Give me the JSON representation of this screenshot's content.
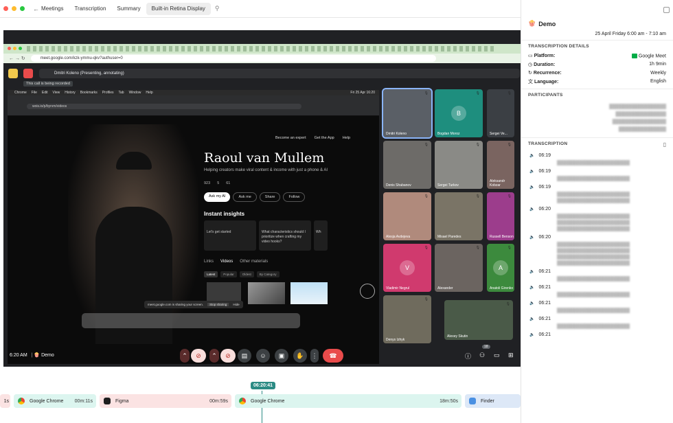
{
  "topbar": {
    "back_label": "Meetings",
    "tabs": [
      "Transcription",
      "Summary",
      "Built-in Retina Display"
    ]
  },
  "panel": {
    "title": "Demo",
    "datetime": "25 April Friday 6:00 am - 7:10 am",
    "details_heading": "TRANSCRIPTION DETAILS",
    "details": [
      {
        "label": "Platform:",
        "value": "Google Meet"
      },
      {
        "label": "Duration:",
        "value": "1h 9min"
      },
      {
        "label": "Recurrence:",
        "value": "Weekly"
      },
      {
        "label": "Language:",
        "value": "English"
      }
    ],
    "participants_heading": "PARTICIPANTS",
    "transcription_heading": "TRANSCRIPTION",
    "timestamps": [
      "06:19",
      "06:19",
      "06:19",
      "06:20",
      "06:20",
      "06:21",
      "06:21",
      "06:21",
      "06:21",
      "06:21"
    ]
  },
  "browser": {
    "url": "meet.google.com/kzk-ymmu-qkv?authuser=0",
    "presenter": "Dmitri Koleno (Presenting, annotating)",
    "recording_note": "This call is being recorded",
    "inner_url": "wois.io/p/byrvm/videos",
    "menu": [
      "Chrome",
      "File",
      "Edit",
      "View",
      "History",
      "Bookmarks",
      "Profiles",
      "Tab",
      "Window",
      "Help"
    ],
    "clock": "Fri 25 Apr 16:20"
  },
  "profile": {
    "name": "Raoul van Mullem",
    "tagline": "Helping creators make viral content & income with just a phone & AI",
    "stats": [
      "923",
      "5",
      "61"
    ],
    "buttons": [
      "Ask my AI",
      "Ask me",
      "Share",
      "Follow"
    ],
    "nav": [
      "Become an expert",
      "Get the App",
      "Help"
    ],
    "insights_heading": "Instant insights",
    "cards": [
      "Let's get started",
      "What characteristics should I prioritize when crafting my video hooks?",
      "Wh"
    ],
    "tabs": [
      "Links",
      "Videos",
      "Other materials"
    ],
    "filters": [
      "Latest",
      "Popular",
      "Oldest",
      "By Category"
    ],
    "share_notice": "meet.google.com is sharing your screen.",
    "stop_label": "Stop sharing",
    "hide_label": "Hide"
  },
  "participants": [
    {
      "name": "Dmitri Koleno",
      "initial": "",
      "color": "#5a5f66"
    },
    {
      "name": "Bogdan Moroz",
      "initial": "B",
      "color": "#1e8e7e"
    },
    {
      "name": "Sergei Ve...",
      "initial": "",
      "color": "#3b3f44"
    },
    {
      "name": "Denis Shabanov",
      "initial": "",
      "color": "#6d6b68"
    },
    {
      "name": "Sergei Turkov",
      "initial": "",
      "color": "#8a8a86"
    },
    {
      "name": "Aleksandr Kobzar",
      "initial": "",
      "color": "#7a6460"
    },
    {
      "name": "Alesja Avdejeva",
      "initial": "",
      "color": "#b08a7c"
    },
    {
      "name": "Misael Paredes",
      "initial": "",
      "color": "#7a7466"
    },
    {
      "name": "Russell Benson",
      "initial": "",
      "color": "#9c3d8c"
    },
    {
      "name": "Vladimir Negrul",
      "initial": "V",
      "color": "#d03a6e"
    },
    {
      "name": "Alexander",
      "initial": "",
      "color": "#6b6460"
    },
    {
      "name": "Anatoli Girenko",
      "initial": "A",
      "color": "#3c8a3d"
    },
    {
      "name": "Denys Izhyk",
      "initial": "",
      "color": "#6f6b5d"
    },
    {
      "name": "Alexey Skutin",
      "initial": "",
      "color": "#4a5a48"
    }
  ],
  "meetbar": {
    "time": "6:20 AM",
    "meeting": "Demo",
    "people_count": "18"
  },
  "timeline": {
    "current": "06:20:41",
    "segments": [
      {
        "label": "1s",
        "time": ""
      },
      {
        "label": "Google Chrome",
        "time": "00m:11s"
      },
      {
        "label": "Figma",
        "time": "00m:59s"
      },
      {
        "label": "Google Chrome",
        "time": "18m:50s"
      },
      {
        "label": "Finder",
        "time": ""
      }
    ]
  },
  "colors": {
    "accent_red": "#e94b4b",
    "chrome_green": "#cfe6c9",
    "seg_pink": "#fbe3e3",
    "seg_mint": "#dcf5ef",
    "seg_blue": "#dde8f7",
    "marker_teal": "#2b8b84"
  },
  "icons": [
    "back-arrow-icon",
    "pin-icon",
    "popcorn-icon",
    "google-meet-icon",
    "clock-icon",
    "repeat-icon",
    "globe-icon",
    "document-icon",
    "speaker-icon",
    "mic-icon"
  ]
}
